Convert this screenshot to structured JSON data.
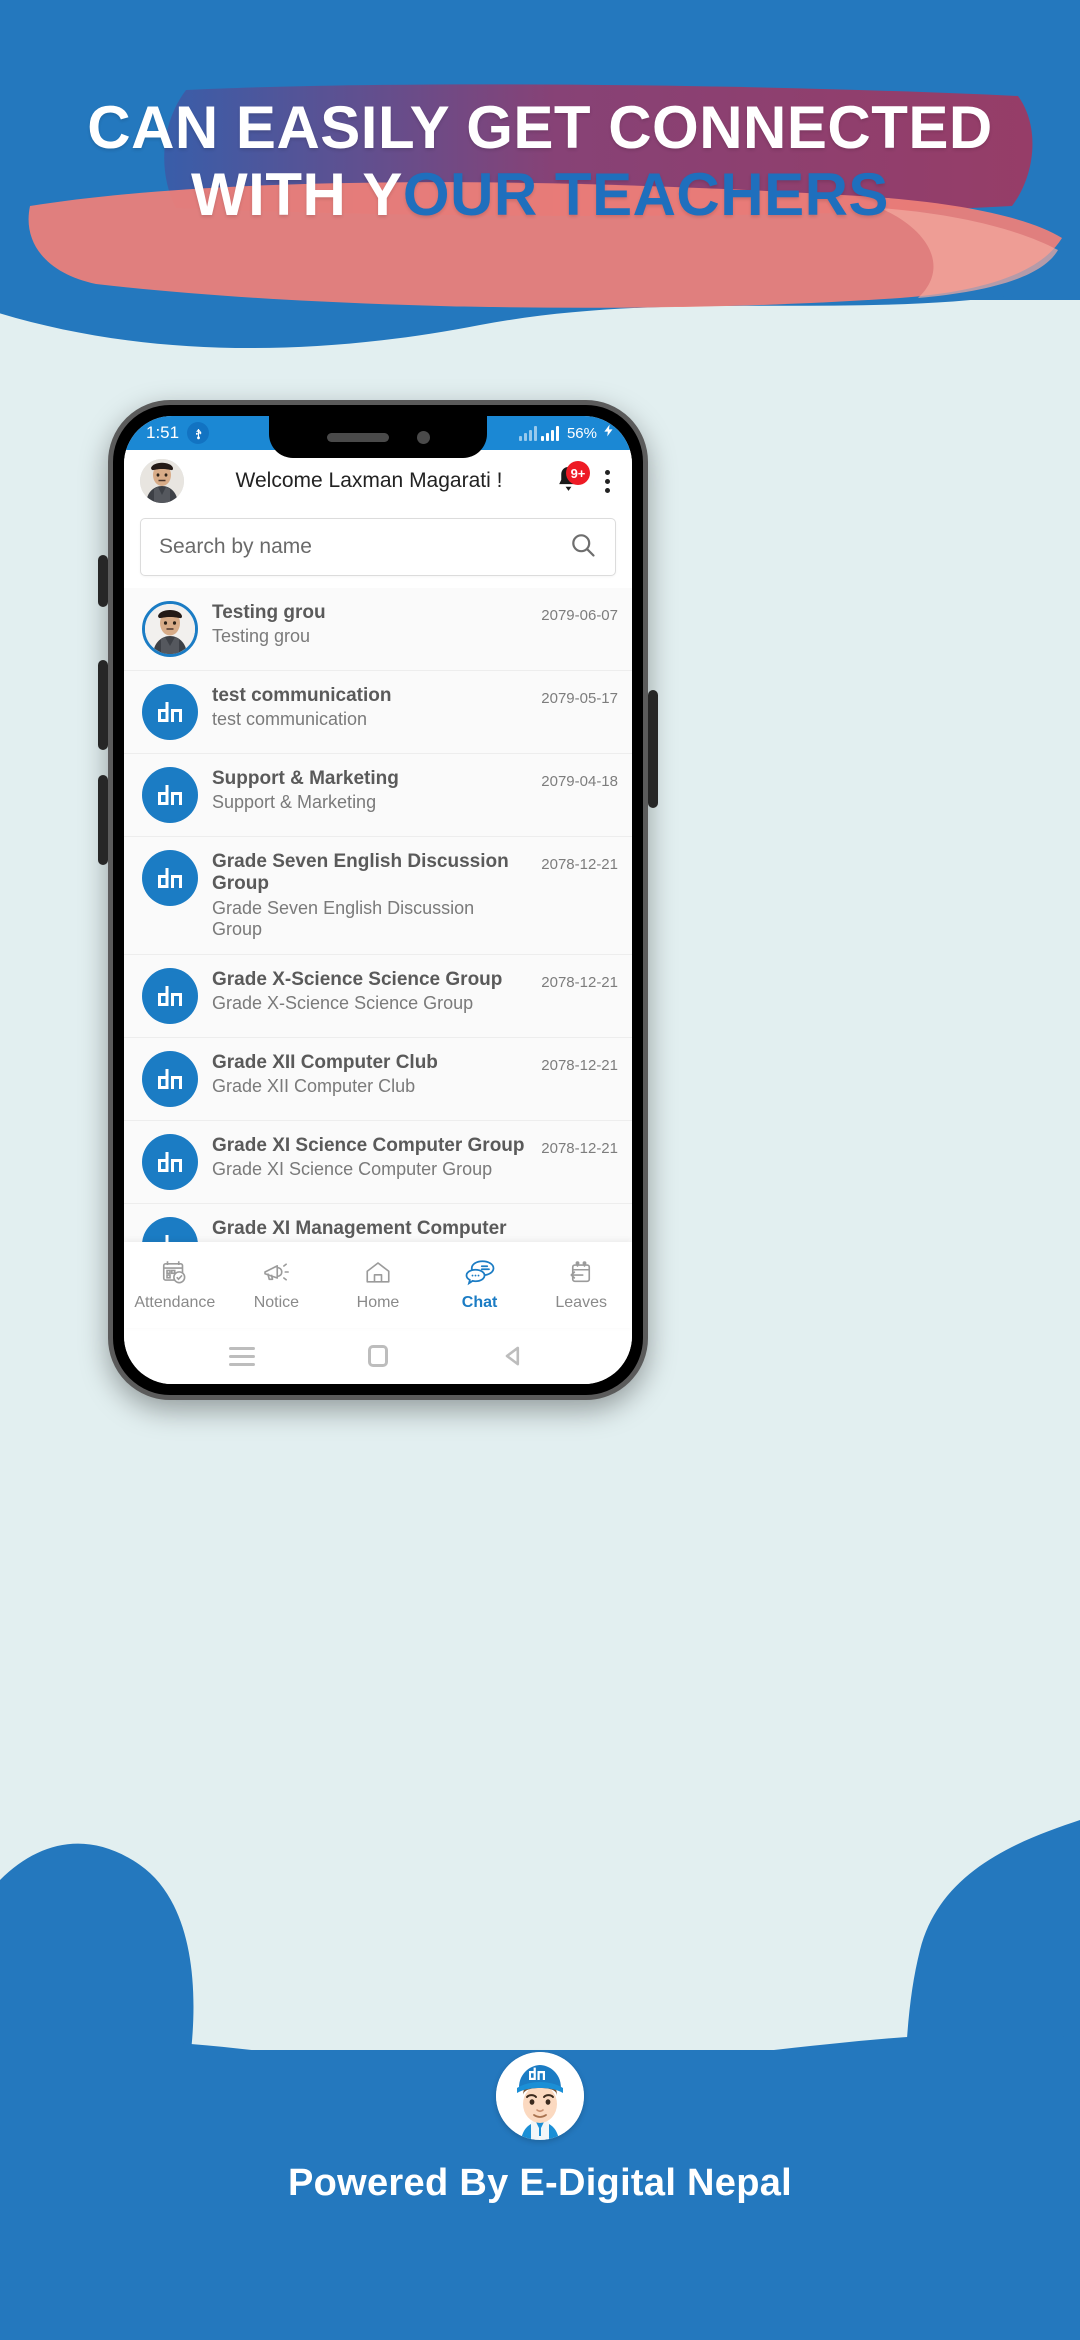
{
  "promo": {
    "headline_line1": "CAN EASILY GET CONNECTED",
    "headline_line2_white": "WITH Y",
    "headline_line2_blue": "OUR TEACHERS",
    "footer_text": "Powered By E-Digital Nepal",
    "brand_initials": "dn"
  },
  "colors": {
    "brand_blue": "#1b7cc4",
    "header_blue": "#2478be",
    "backdrop": "#e2eff0",
    "brush_pink": "#ef8078",
    "brush_purple": "#8c3f72",
    "badge_red": "#ee1b25"
  },
  "statusbar": {
    "time": "1:51",
    "usb_icon": "usb-icon",
    "battery_percent": "56%",
    "charging_icon": "charging-bolt-icon"
  },
  "appbar": {
    "avatar": "user-avatar",
    "title": "Welcome Laxman Magarati !",
    "notification_badge": "9+",
    "bell_icon": "bell-icon",
    "menu_icon": "kebab-menu-icon"
  },
  "search": {
    "value": "",
    "placeholder": "Search by name",
    "icon": "search-icon"
  },
  "chats": [
    {
      "title": "Testing grou",
      "subtitle": "Testing grou",
      "date": "2079-06-07",
      "avatar_type": "photo"
    },
    {
      "title": "test communication",
      "subtitle": "test communication",
      "date": "2079-05-17",
      "avatar_type": "logo"
    },
    {
      "title": "Support & Marketing",
      "subtitle": "Support & Marketing",
      "date": "2079-04-18",
      "avatar_type": "logo"
    },
    {
      "title": "Grade Seven English Discussion Group",
      "subtitle": "Grade Seven English Discussion Group",
      "date": "2078-12-21",
      "avatar_type": "logo"
    },
    {
      "title": "Grade X-Science Science Group",
      "subtitle": "Grade X-Science Science Group",
      "date": "2078-12-21",
      "avatar_type": "logo"
    },
    {
      "title": "Grade XII Computer Club",
      "subtitle": "Grade XII Computer Club",
      "date": "2078-12-21",
      "avatar_type": "logo"
    },
    {
      "title": "Grade XI Science Computer Group",
      "subtitle": "Grade XI Science Computer Group",
      "date": "2078-12-21",
      "avatar_type": "logo"
    },
    {
      "title": "Grade XI Management Computer",
      "subtitle": "",
      "date": "",
      "avatar_type": "logo"
    }
  ],
  "bottom_nav": {
    "active": "Chat",
    "items": [
      {
        "label": "Attendance",
        "icon": "calendar-check-icon"
      },
      {
        "label": "Notice",
        "icon": "megaphone-icon"
      },
      {
        "label": "Home",
        "icon": "home-icon"
      },
      {
        "label": "Chat",
        "icon": "chat-bubbles-icon"
      },
      {
        "label": "Leaves",
        "icon": "calendar-arrow-icon"
      }
    ]
  },
  "android_nav": {
    "recent": "menu-lines-icon",
    "home": "home-square-icon",
    "back": "back-triangle-icon"
  }
}
